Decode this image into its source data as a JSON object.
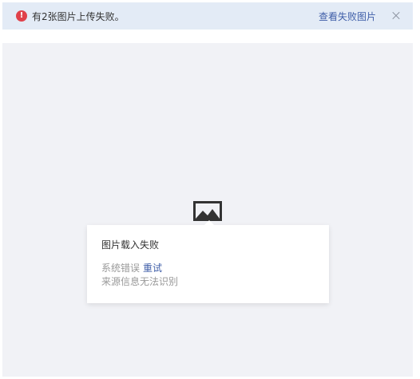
{
  "notice": {
    "icon": "exclamation-circle-icon",
    "icon_glyph": "!",
    "message": "有2张图片上传失败。",
    "link_label": "查看失败图片",
    "close": "close-icon",
    "accent_color": "#e0414a",
    "link_color": "#3f5ea8"
  },
  "viewer": {
    "image_icon": "image-placeholder-icon",
    "card": {
      "title": "图片载入失败",
      "error_text": "系统错误",
      "retry_label": "重试",
      "source_text": "来源信息无法识别"
    }
  }
}
